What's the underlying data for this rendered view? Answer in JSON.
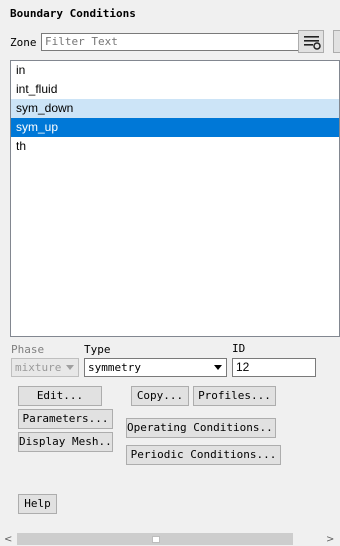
{
  "panel": {
    "title": "Boundary Conditions",
    "zone_label": "Zone",
    "filter_placeholder": "Filter Text"
  },
  "zones": [
    {
      "label": "in",
      "state": "normal"
    },
    {
      "label": "int_fluid",
      "state": "normal"
    },
    {
      "label": "sym_down",
      "state": "hover"
    },
    {
      "label": "sym_up",
      "state": "selected"
    },
    {
      "label": "th",
      "state": "normal"
    }
  ],
  "phase": {
    "label": "Phase",
    "value": "mixture"
  },
  "type": {
    "label": "Type",
    "value": "symmetry"
  },
  "id": {
    "label": "ID",
    "value": "12"
  },
  "buttons": {
    "edit": "Edit...",
    "copy": "Copy...",
    "profiles": "Profiles...",
    "parameters": "Parameters...",
    "operating_conditions": "Operating Conditions...",
    "display_mesh": "Display Mesh...",
    "periodic_conditions": "Periodic Conditions...",
    "help": "Help"
  },
  "scrollbar": {
    "left_arrow": "<",
    "right_arrow": ">"
  },
  "icons": {
    "filter": "filter-list-icon"
  },
  "colors": {
    "selection": "#0078d7",
    "hover": "#cce4f7"
  }
}
